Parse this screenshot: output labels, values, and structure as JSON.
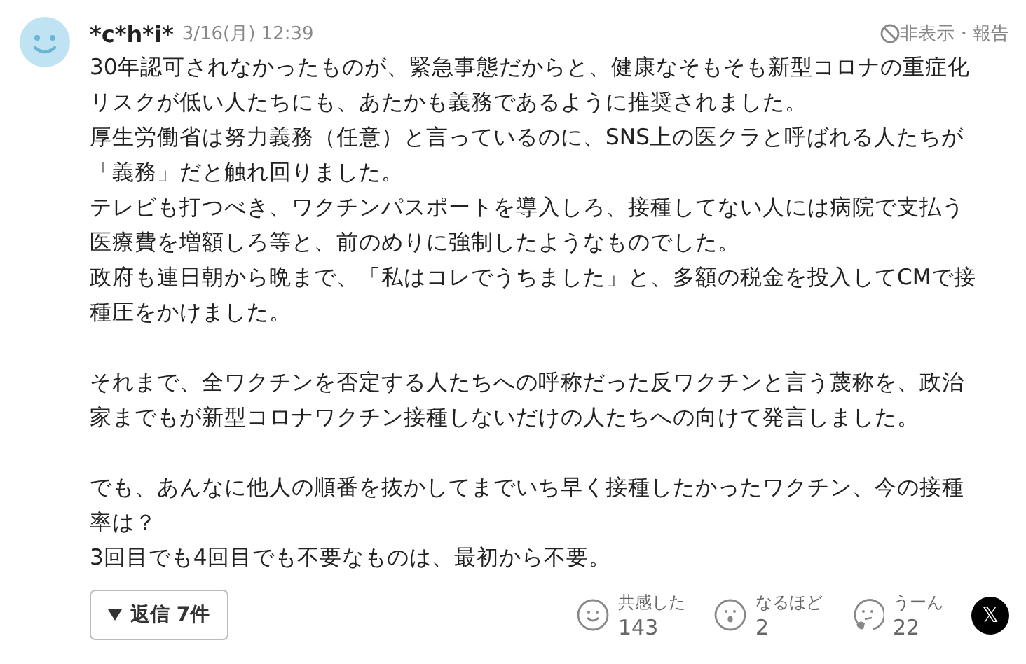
{
  "comment": {
    "author": "*c*h*i*",
    "time": "3/16(月) 12:39",
    "hide_report": "非表示・報告",
    "paragraphs": [
      {
        "lines": [
          "30年認可されなかったものが、緊急事態だからと、健康なそもそも新型コロナの重症化",
          "リスクが低い人たちにも、あたかも義務であるように推奨されました。",
          "厚生労働省は努力義務（任意）と言っているのに、SNS上の医クラと呼ばれる人たちが",
          "「義務」だと触れ回りました。",
          "テレビも打つべき、ワクチンパスポートを導入しろ、接種してない人には病院で支払う",
          "医療費を増額しろ等と、前のめりに強制したようなものでした。",
          "政府も連日朝から晩まで、「私はコレでうちました」と、多額の税金を投入してCMで接",
          "種圧をかけました。"
        ]
      },
      {
        "lines": [
          "それまで、全ワクチンを否定する人たちへの呼称だった反ワクチンと言う蔑称を、政治",
          "家までもが新型コロナワクチン接種しないだけの人たちへの向けて発言しました。"
        ]
      },
      {
        "lines": [
          "でも、あんなに他人の順番を抜かしてまでいち早く接種したかったワクチン、今の接種",
          "率は？",
          "3回目でも4回目でも不要なものは、最初から不要。"
        ]
      }
    ],
    "replies_button": "返信 7件",
    "reactions": [
      {
        "kind": "smile",
        "label": "共感した",
        "count": "143"
      },
      {
        "kind": "surprise",
        "label": "なるほど",
        "count": "2"
      },
      {
        "kind": "think",
        "label": "うーん",
        "count": "22"
      }
    ],
    "share_x": "𝕏"
  }
}
